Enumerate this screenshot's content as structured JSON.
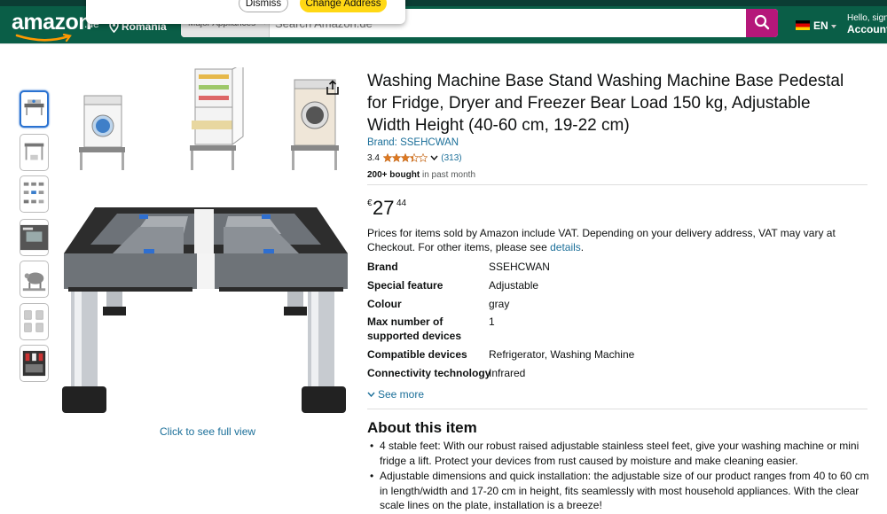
{
  "header": {
    "logo_text": "amazon",
    "logo_tld": ".de",
    "deliver_location": "Romania",
    "search_category": "Major Appliances",
    "search_placeholder": "Search Amazon.de",
    "language": "EN",
    "account_line1": "Hello, sign in",
    "account_line2": "Account & Lists"
  },
  "popup": {
    "dismiss_label": "Dismiss",
    "change_label": "Change Address"
  },
  "product": {
    "title": "Washing Machine Base Stand Washing Machine Base Pedestal for Fridge, Dryer and Freezer Bear Load 150 kg, Adjustable Width Height (40-60 cm, 19-22 cm)",
    "brand_link": "Brand: SSEHCWAN",
    "rating_value": "3.4",
    "rating_stars": 3.4,
    "rating_count": "(313)",
    "bought_bold": "200+ bought",
    "bought_rest": " in past month",
    "price_symbol": "€",
    "price_whole": "27",
    "price_fraction": "44",
    "vat_text": "Prices for items sold by Amazon include VAT. Depending on your delivery address, VAT may vary at Checkout. For other items, please see ",
    "vat_link": "details",
    "vat_end": ".",
    "click_full_view": "Click to see full view"
  },
  "specs": [
    {
      "key": "Brand",
      "value": "SSEHCWAN"
    },
    {
      "key": "Special feature",
      "value": "Adjustable"
    },
    {
      "key": "Colour",
      "value": "gray"
    },
    {
      "key": "Max number of supported devices",
      "value": "1"
    },
    {
      "key": "Compatible devices",
      "value": "Refrigerator, Washing Machine"
    },
    {
      "key": "Connectivity technology",
      "value": "Infrared"
    }
  ],
  "see_more": "See more",
  "about": {
    "title": "About this item",
    "bullets": [
      "4 stable feet: With our robust raised adjustable stainless steel feet, give your washing machine or mini fridge a lift. Protect your devices from rust caused by moisture and make cleaning easier.",
      "Adjustable dimensions and quick installation: the adjustable size of our product ranges from 40 to 60 cm in length/width and 17-20 cm in height, fits seamlessly with most household appliances. With the clear scale lines on the plate, installation is a breeze!"
    ]
  },
  "colors": {
    "header_bg": "#0a5e47",
    "search_button": "#b5177a",
    "link": "#1b6f99",
    "star": "#de7921",
    "popup_primary": "#ffd814"
  },
  "icons": [
    "map-pin-icon",
    "search-icon",
    "flag-icon",
    "share-icon",
    "star-icon",
    "chevron-down-icon"
  ]
}
